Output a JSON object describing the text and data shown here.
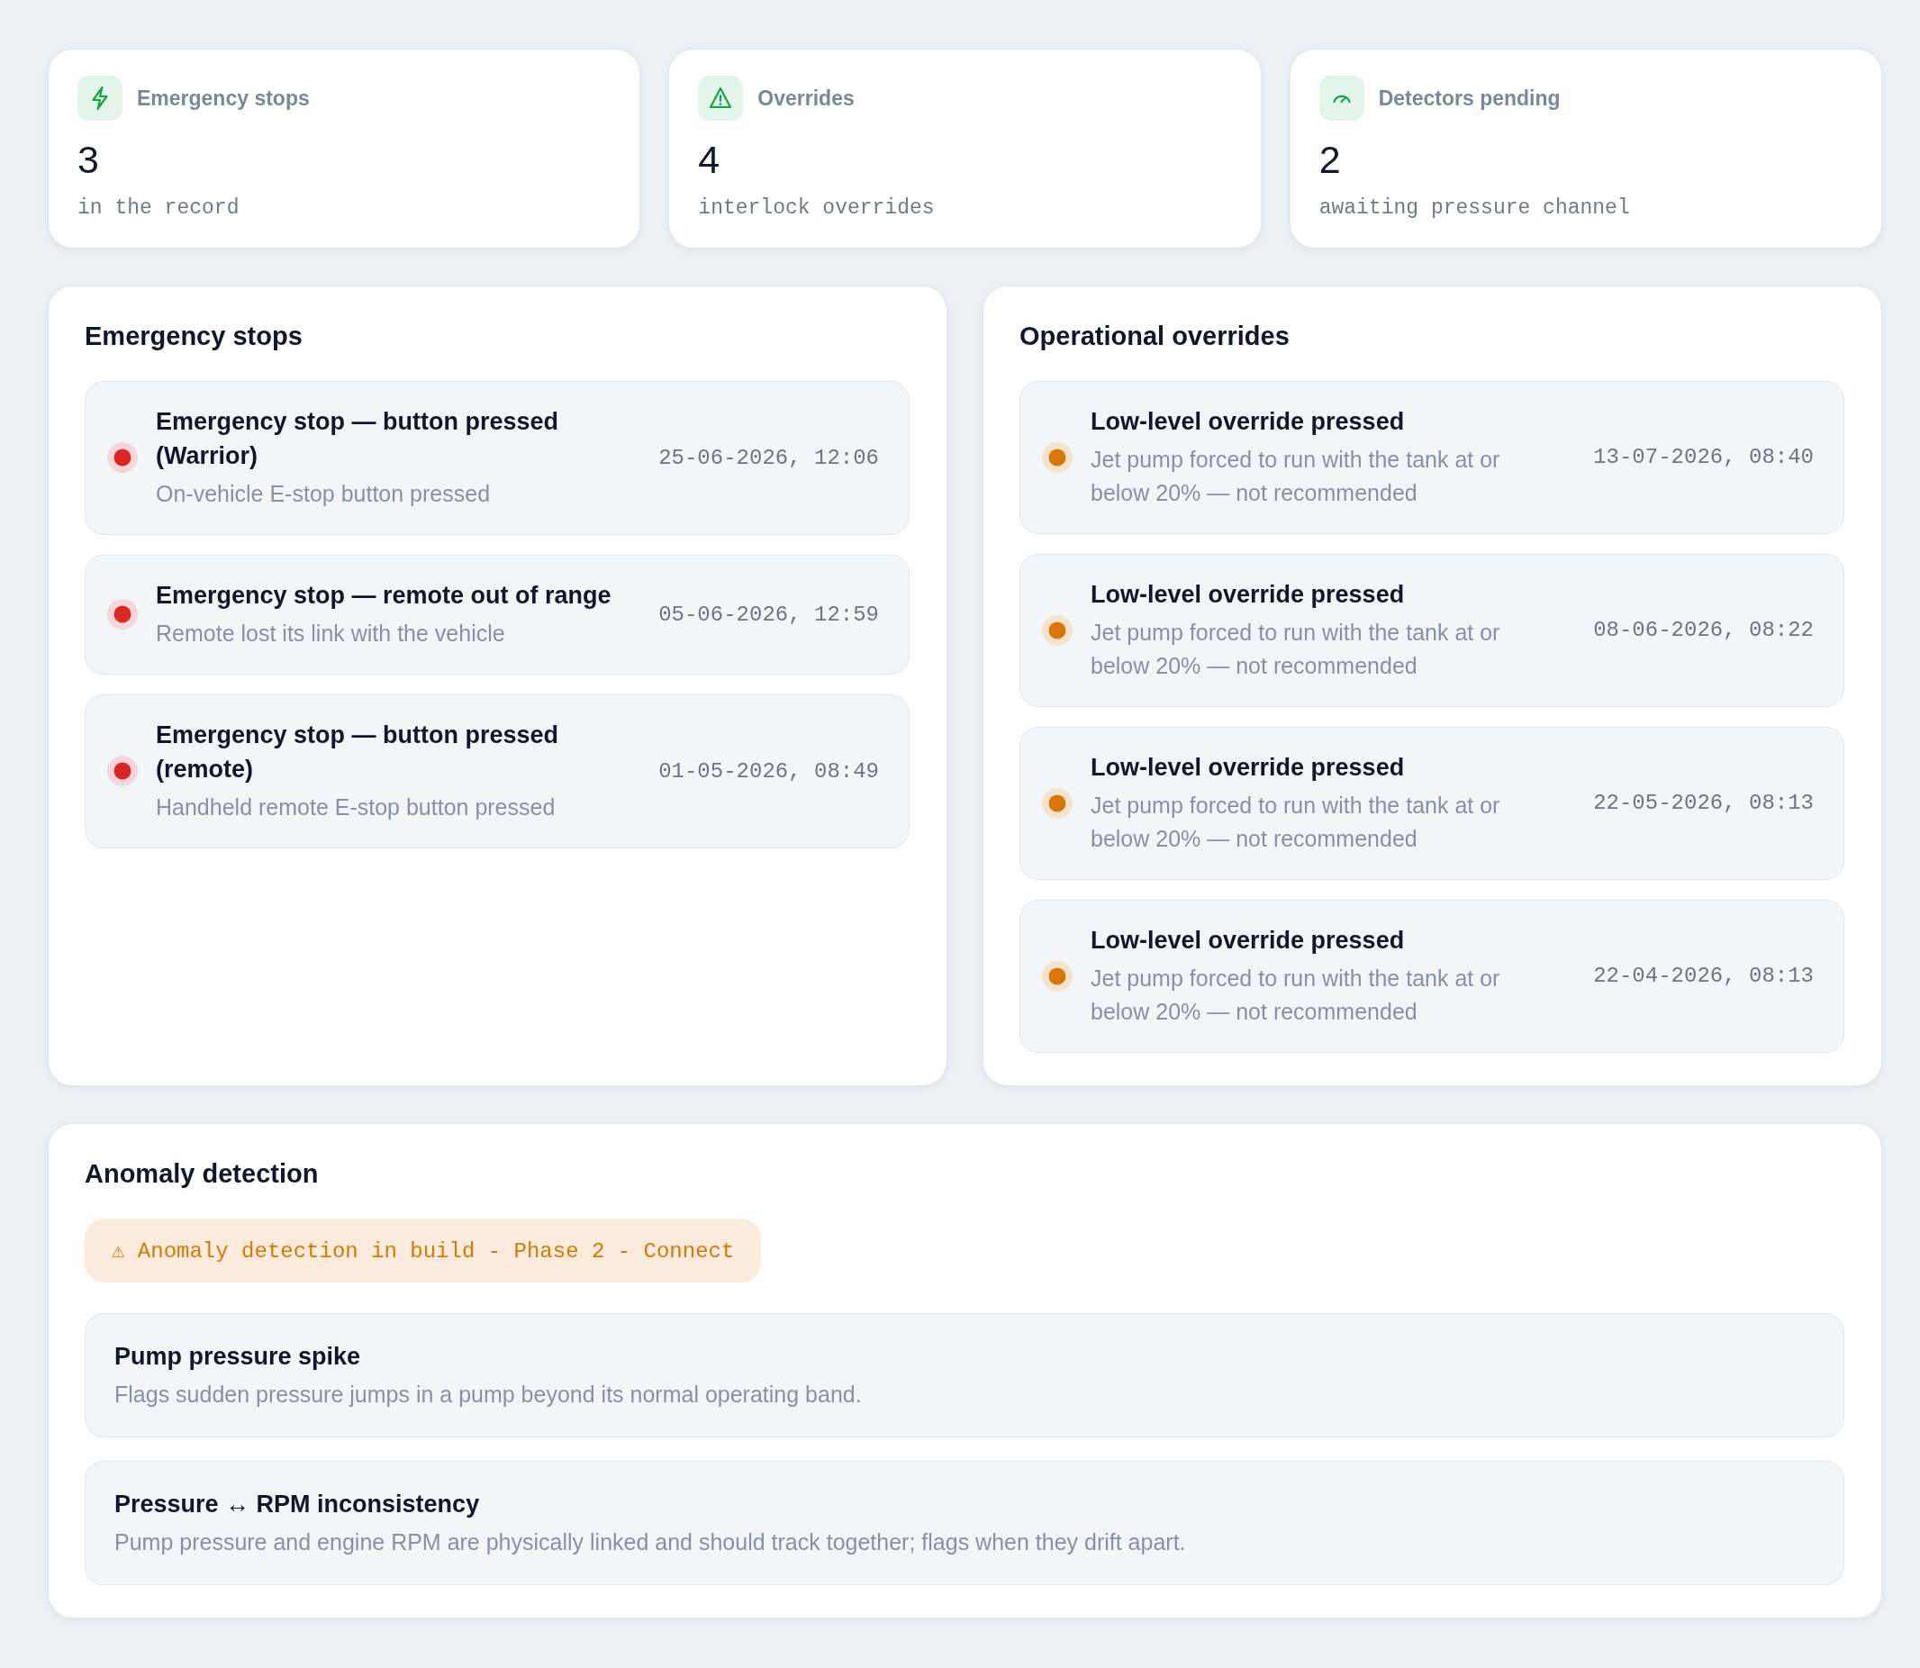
{
  "stats": [
    {
      "label": "Emergency stops",
      "value": "3",
      "note": "in the record"
    },
    {
      "label": "Overrides",
      "value": "4",
      "note": "interlock overrides"
    },
    {
      "label": "Detectors pending",
      "value": "2",
      "note": "awaiting pressure channel"
    }
  ],
  "panels": [
    {
      "kind": "critical",
      "title": "Emergency stops",
      "events": [
        {
          "title": "Emergency stop — button pressed (Warrior)",
          "detail": "On-vehicle E-stop button pressed",
          "time": "25-06-2026, 12:06"
        },
        {
          "title": "Emergency stop — remote out of range",
          "detail": "Remote lost its link with the vehicle",
          "time": "05-06-2026, 12:59"
        },
        {
          "title": "Emergency stop — button pressed (remote)",
          "detail": "Handheld remote E-stop button pressed",
          "time": "01-05-2026, 08:49"
        }
      ]
    },
    {
      "kind": "warning",
      "title": "Operational overrides",
      "events": [
        {
          "title": "Low-level override pressed",
          "detail": "Jet pump forced to run with the tank at or below 20% — not recommended",
          "time": "13-07-2026, 08:40"
        },
        {
          "title": "Low-level override pressed",
          "detail": "Jet pump forced to run with the tank at or below 20% — not recommended",
          "time": "08-06-2026, 08:22"
        },
        {
          "title": "Low-level override pressed",
          "detail": "Jet pump forced to run with the tank at or below 20% — not recommended",
          "time": "22-05-2026, 08:13"
        },
        {
          "title": "Low-level override pressed",
          "detail": "Jet pump forced to run with the tank at or below 20% — not recommended",
          "time": "22-04-2026, 08:13"
        }
      ]
    }
  ],
  "anomaly": {
    "title": "Anomaly detection",
    "notice": "⚠ Anomaly detection in build - Phase 2 - Connect",
    "detectors": [
      {
        "name": "Pump pressure spike",
        "description": "Flags sudden pressure jumps in a pump beyond its normal operating band."
      },
      {
        "name": "Pressure ↔ RPM inconsistency",
        "description": "Pump pressure and engine RPM are physically linked and should track together; flags when they drift apart."
      }
    ]
  }
}
